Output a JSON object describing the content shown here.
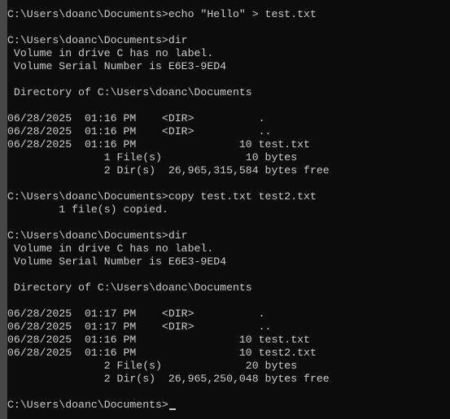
{
  "console": {
    "lines": [
      "C:\\Users\\doanc\\Documents>echo \"Hello\" > test.txt",
      "",
      "C:\\Users\\doanc\\Documents>dir",
      " Volume in drive C has no label.",
      " Volume Serial Number is E6E3-9ED4",
      "",
      " Directory of C:\\Users\\doanc\\Documents",
      "",
      "06/28/2025  01:16 PM    <DIR>          .",
      "06/28/2025  01:16 PM    <DIR>          ..",
      "06/28/2025  01:16 PM                10 test.txt",
      "               1 File(s)             10 bytes",
      "               2 Dir(s)  26,965,315,584 bytes free",
      "",
      "C:\\Users\\doanc\\Documents>copy test.txt test2.txt",
      "        1 file(s) copied.",
      "",
      "C:\\Users\\doanc\\Documents>dir",
      " Volume in drive C has no label.",
      " Volume Serial Number is E6E3-9ED4",
      "",
      " Directory of C:\\Users\\doanc\\Documents",
      "",
      "06/28/2025  01:17 PM    <DIR>          .",
      "06/28/2025  01:17 PM    <DIR>          ..",
      "06/28/2025  01:16 PM                10 test.txt",
      "06/28/2025  01:16 PM                10 test2.txt",
      "               2 File(s)             20 bytes",
      "               2 Dir(s)  26,965,250,048 bytes free",
      ""
    ],
    "prompt": "C:\\Users\\doanc\\Documents>"
  },
  "colors": {
    "background": "#0c0c0c",
    "foreground": "#cccccc"
  }
}
